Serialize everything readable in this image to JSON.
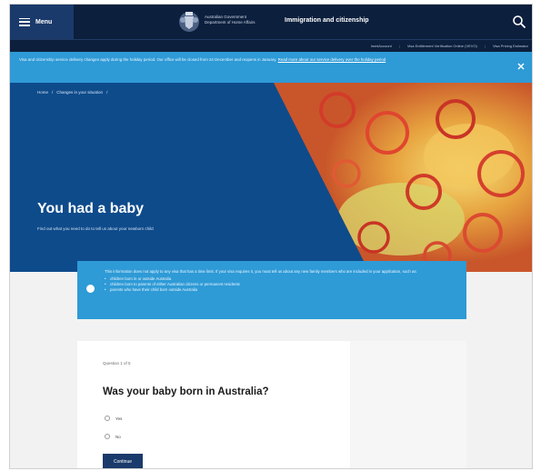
{
  "header": {
    "menu_label": "Menu",
    "gov_line1": "Australian Government",
    "gov_line2": "Department of Home Affairs",
    "portal_title": "Immigration and citizenship",
    "icons": {
      "menu": "hamburger-icon",
      "crest": "coat-of-arms-icon",
      "search": "search-icon"
    }
  },
  "sublinks": {
    "items": [
      "ImmiAccount",
      "Visa Entitlement Verification Online (VEVO)",
      "Visa Pricing Estimator"
    ],
    "separator": "|"
  },
  "alert": {
    "text": "Visa and citizenship service delivery changes apply during the holiday period. Our office will be closed from 24 December and reopens in January.",
    "link_text": "Read more about our service delivery over the holiday period",
    "icon": "close-icon"
  },
  "breadcrumb": {
    "items": [
      "Home",
      "Changes in your situation"
    ],
    "separator": "/"
  },
  "hero": {
    "title": "You had a baby",
    "subtitle": "Find out what you need to do to tell us about your newborn child"
  },
  "notice": {
    "intro": "This information does not apply to any visa that has a time limit. If your visa requires it, you must tell us about any new family members who are included in your application, such as:",
    "items": [
      "children born in or outside Australia",
      "children born to parents of either Australian citizens or permanent residents",
      "parents who have their child born outside Australia"
    ],
    "icon": "info-bullet-icon"
  },
  "question": {
    "count": "Question 1 of 5",
    "title": "Was your baby born in Australia?",
    "options": [
      "Yes",
      "No"
    ],
    "continue_label": "Continue"
  },
  "colors": {
    "header_bg": "#0c1f3d",
    "menu_bg": "#1a3a6b",
    "alert_bg": "#2e9ad6",
    "hero_bg": "#0e4b8b",
    "button_bg": "#1a3a6b"
  }
}
